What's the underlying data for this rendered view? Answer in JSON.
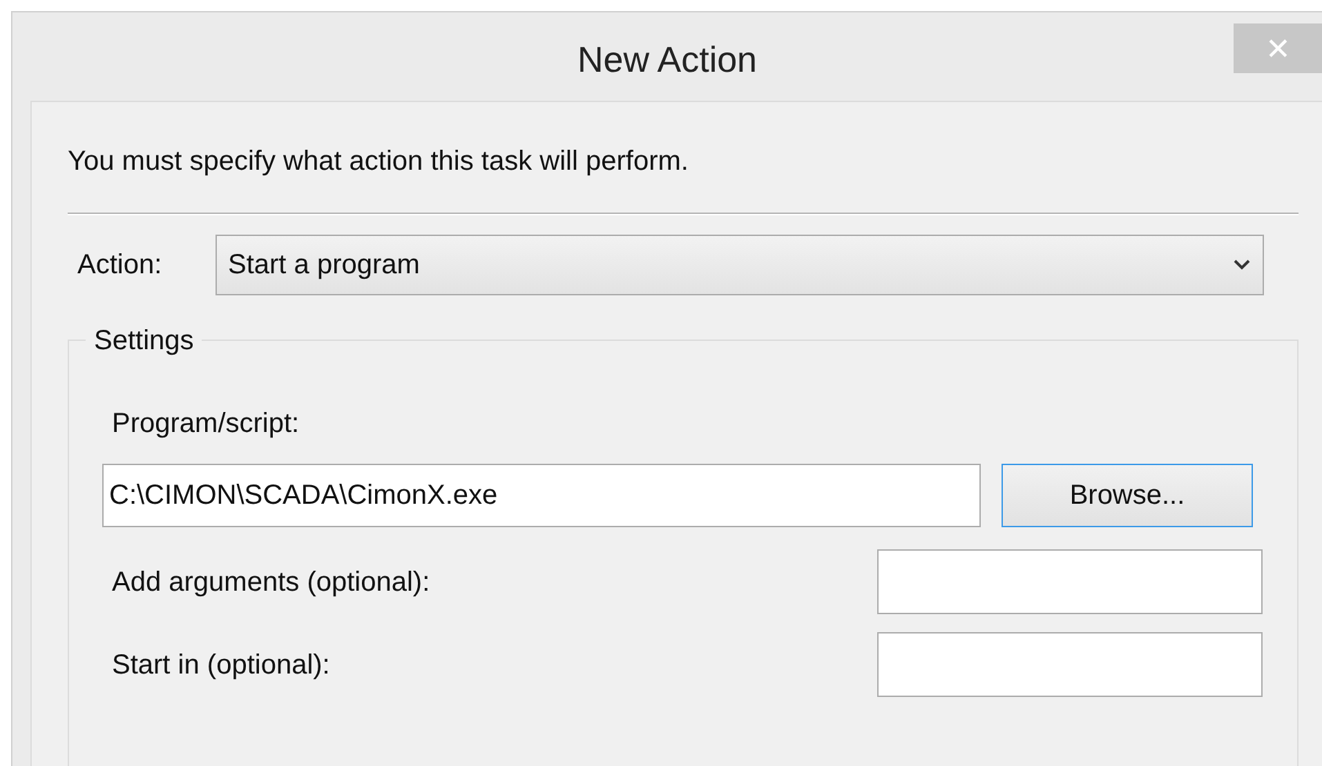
{
  "window": {
    "title": "New Action",
    "close": "✕"
  },
  "instruction": "You must specify what action this task will perform.",
  "action": {
    "label": "Action:",
    "value": "Start a program"
  },
  "settings": {
    "legend": "Settings",
    "program": {
      "label": "Program/script:",
      "value": "C:\\CIMON\\SCADA\\CimonX.exe",
      "button": "Browse..."
    },
    "fields": [
      {
        "label": "Add arguments (optional):"
      },
      {
        "label": "Start in (optional):"
      }
    ]
  }
}
